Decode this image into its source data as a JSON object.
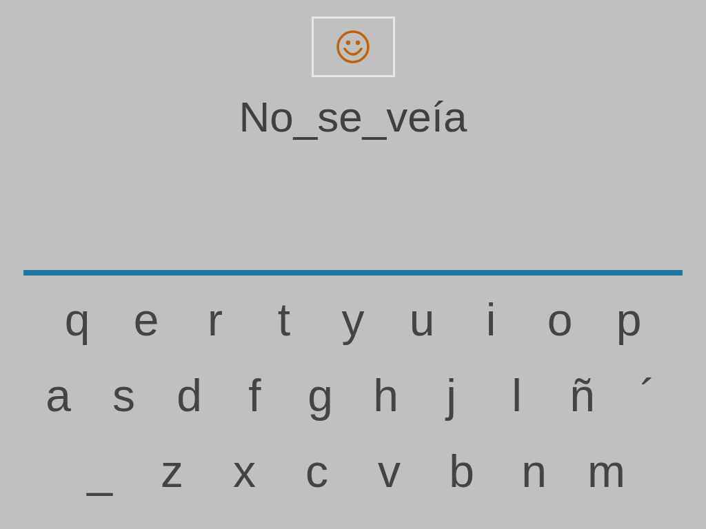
{
  "word": "No_se_veía",
  "keyboard": [
    [
      "q",
      "e",
      "r",
      "t",
      "y",
      "u",
      "i",
      "o",
      "p"
    ],
    [
      "a",
      "s",
      "d",
      "f",
      "g",
      "h",
      "j",
      "l",
      "ñ",
      "´"
    ],
    [
      "_",
      "z",
      "x",
      "c",
      "v",
      "b",
      "n",
      "m"
    ]
  ]
}
